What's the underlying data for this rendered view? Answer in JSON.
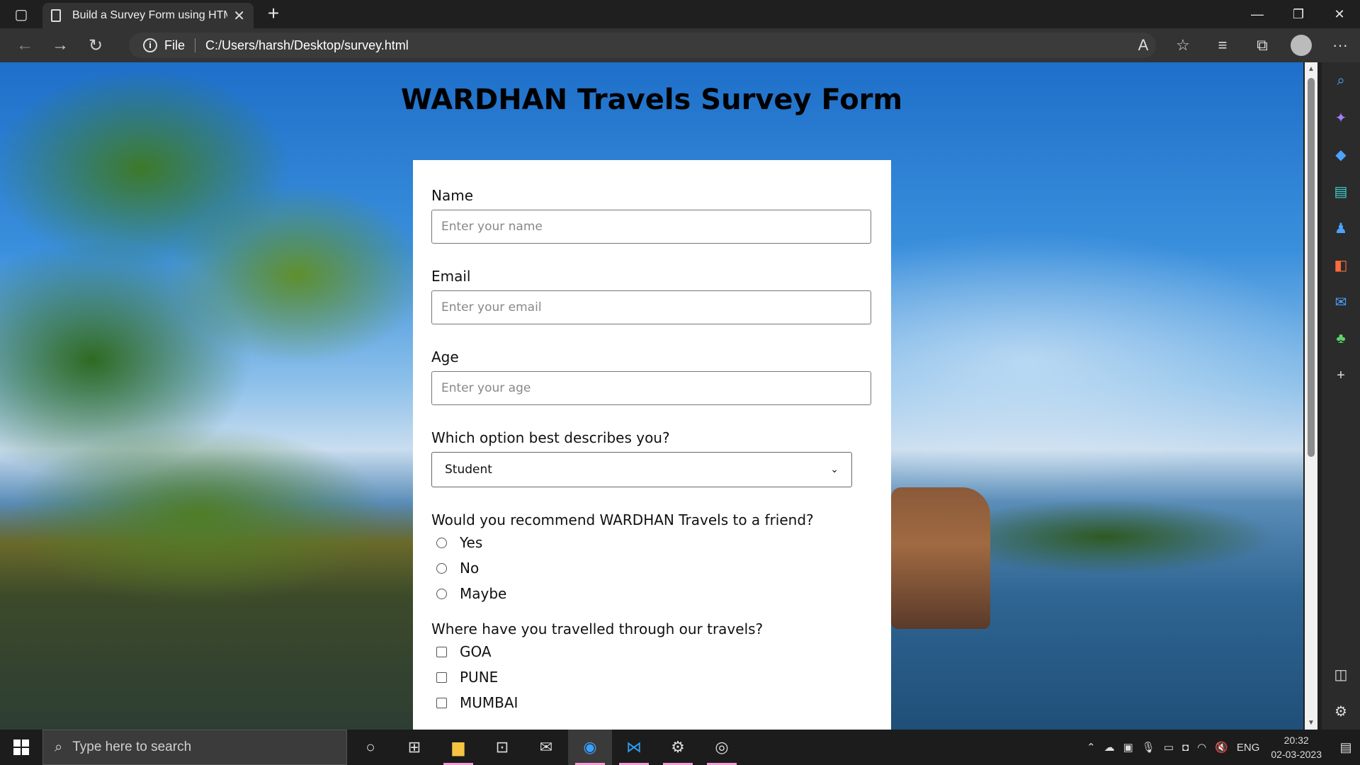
{
  "browser": {
    "tab_title": "Build a Survey Form using HTML",
    "address_prefix": "File",
    "url": "C:/Users/harsh/Desktop/survey.html"
  },
  "page": {
    "title": "WARDHAN Travels Survey Form",
    "form": {
      "name_label": "Name",
      "name_placeholder": "Enter your name",
      "email_label": "Email",
      "email_placeholder": "Enter your email",
      "age_label": "Age",
      "age_placeholder": "Enter your age",
      "describe_label": "Which option best describes you?",
      "describe_selected": "Student",
      "recommend_label": "Would you recommend WARDHAN Travels to a friend?",
      "recommend_options": [
        "Yes",
        "No",
        "Maybe"
      ],
      "travelled_label": "Where have you travelled through our travels?",
      "travelled_options": [
        "GOA",
        "PUNE",
        "MUMBAI"
      ]
    }
  },
  "taskbar": {
    "search_placeholder": "Type here to search",
    "language": "ENG",
    "time": "20:32",
    "date": "02-03-2023"
  }
}
